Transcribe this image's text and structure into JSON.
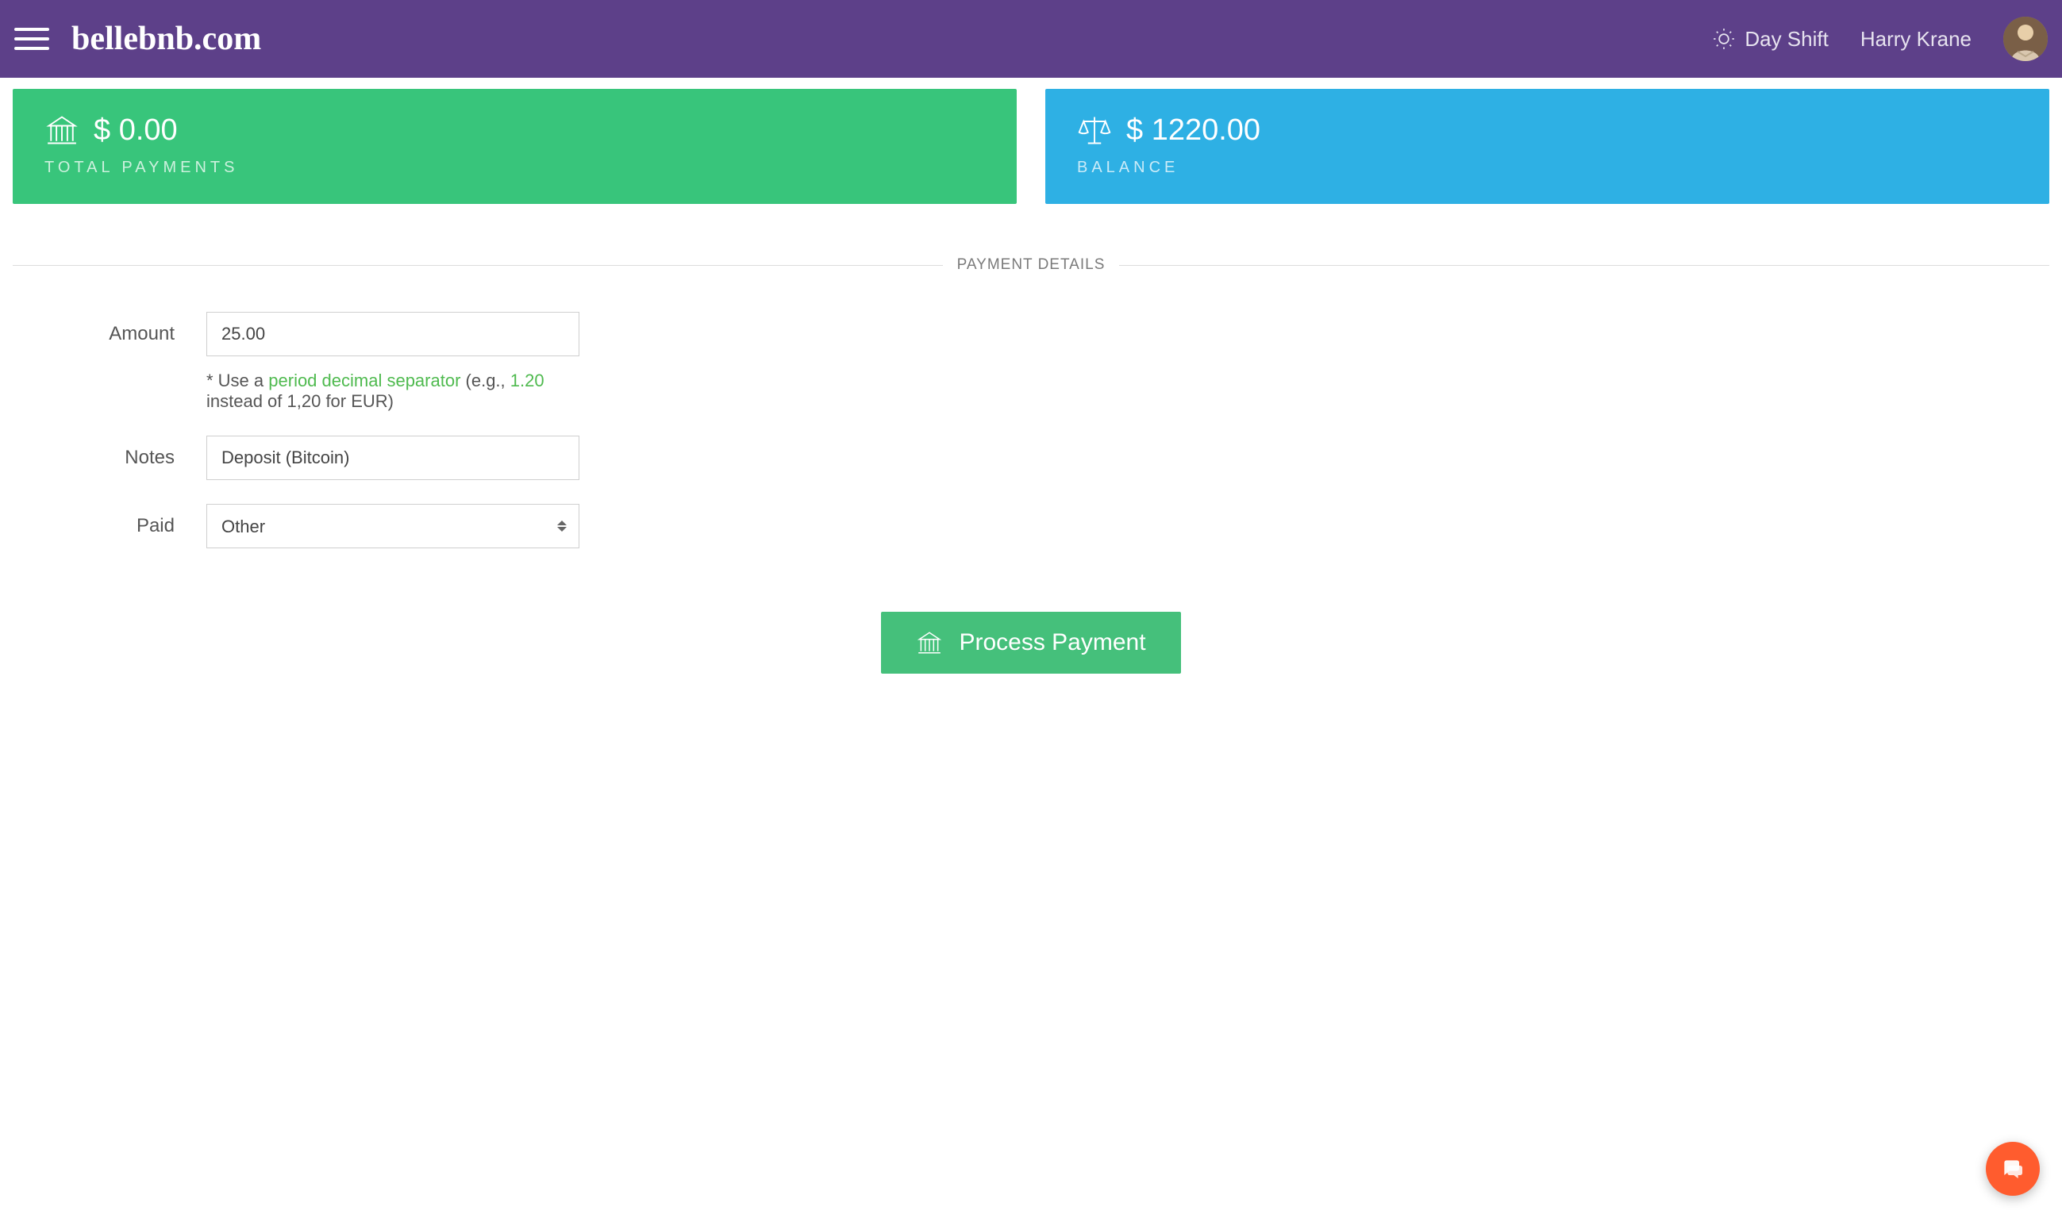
{
  "header": {
    "logo_text": "bellebnb.com",
    "shift_label": "Day Shift",
    "user_name": "Harry Krane"
  },
  "cards": {
    "payments": {
      "value": "$ 0.00",
      "label": "TOTAL PAYMENTS"
    },
    "balance": {
      "value": "$ 1220.00",
      "label": "BALANCE"
    }
  },
  "section_title": "PAYMENT DETAILS",
  "form": {
    "amount_label": "Amount",
    "amount_value": "25.00",
    "hint_prefix": "* Use a ",
    "hint_link": "period decimal separator",
    "hint_mid": " (e.g., ",
    "hint_example": "1.20",
    "hint_suffix": " instead of 1,20 for EUR)",
    "notes_label": "Notes",
    "notes_value": "Deposit (Bitcoin)",
    "paid_label": "Paid",
    "paid_value": "Other"
  },
  "process_button_label": "Process Payment"
}
